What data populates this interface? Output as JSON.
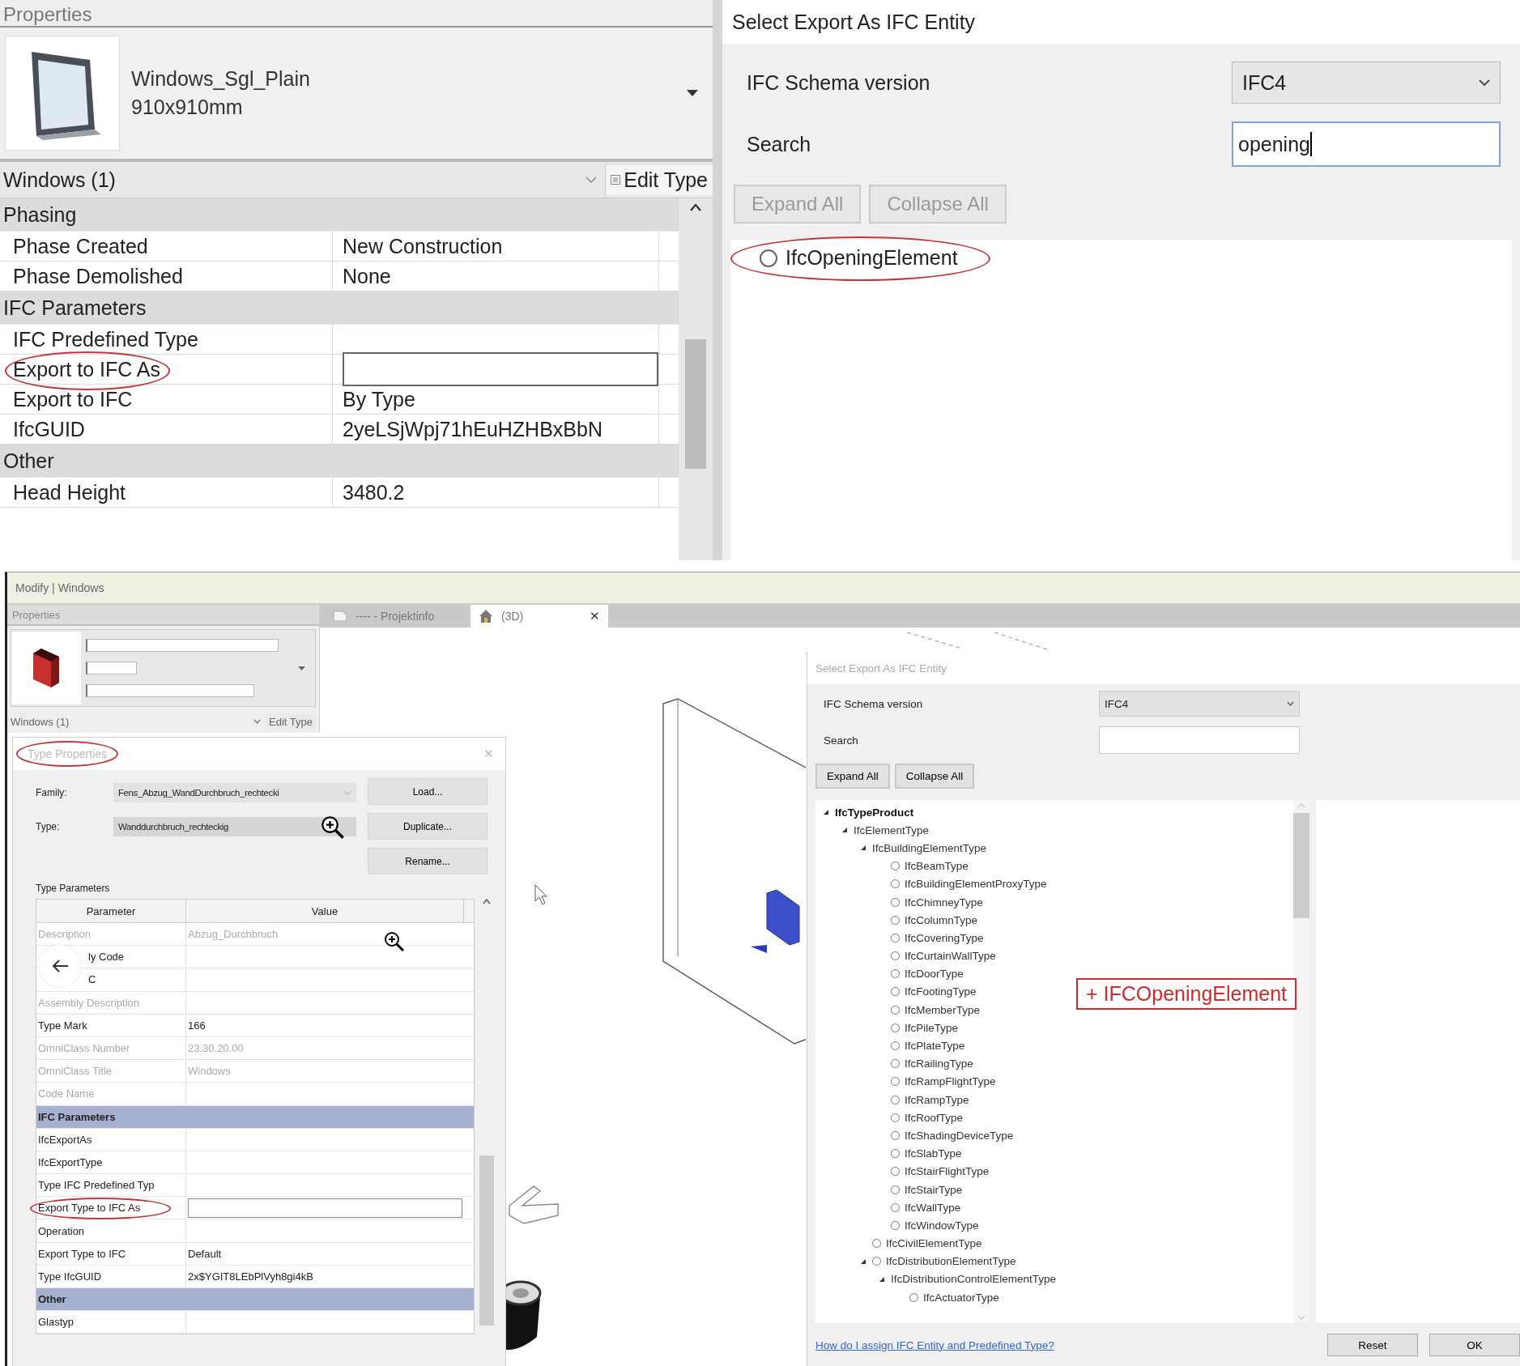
{
  "top_properties": {
    "title": "Properties",
    "type_name": "Windows_Sgl_Plain",
    "type_size": "910x910mm",
    "selector": "Windows (1)",
    "edit_type": "Edit Type",
    "groups": [
      {
        "name": "Phasing",
        "rows": [
          {
            "kind": "text",
            "parameter": "Phase Created",
            "value": "New Construction",
            "circled": false
          },
          {
            "kind": "text",
            "parameter": "Phase Demolished",
            "value": "None",
            "circled": false
          }
        ]
      },
      {
        "name": "IFC Parameters",
        "rows": [
          {
            "kind": "text",
            "parameter": "IFC Predefined Type",
            "circled": false
          },
          {
            "kind": "field",
            "parameter": "Export to IFC As",
            "circled": true
          },
          {
            "kind": "text",
            "parameter": "Export to IFC",
            "value": "By Type",
            "circled": false
          },
          {
            "kind": "text",
            "parameter": "IfcGUID",
            "value": "2yeLSjWpj71hEuHZHBxBbN",
            "circled": false
          }
        ]
      },
      {
        "name": "Other",
        "rows": [
          {
            "kind": "text",
            "parameter": "Head Height",
            "value": "3480.2",
            "circled": false
          }
        ]
      }
    ]
  },
  "top_export": {
    "title": "Select Export As IFC Entity",
    "schema_label": "IFC Schema version",
    "schema_value": "IFC4",
    "search_label": "Search",
    "search_value": "opening",
    "buttons": [
      "Expand All",
      "Collapse All"
    ],
    "results": [
      {
        "label": "IfcOpeningElement",
        "selected": false,
        "circled": true
      }
    ]
  },
  "bottom": {
    "ribbon_title": "Modify | Windows",
    "properties": {
      "title": "Properties",
      "selector": "Windows (1)",
      "edit_type": "Edit Type"
    },
    "tabs": [
      {
        "label": "---- - Projektinfo",
        "selected": false
      },
      {
        "label": "(3D)",
        "selected": true,
        "close": "✕"
      }
    ],
    "type_dialog": {
      "title": "Type Properties",
      "circled": true,
      "close": "✕",
      "family_label": "Family:",
      "family_value": "Fens_Abzug_WandDurchbruch_rechtecki",
      "type_label": "Type:",
      "type_value": "Wanddurchbruch_rechteckig",
      "buttons": [
        "Load...",
        "Duplicate...",
        "Rename..."
      ],
      "section": "Type Parameters",
      "columns": [
        "Parameter",
        "Value"
      ],
      "rows": [
        {
          "kind": "row",
          "parameter": "Description",
          "value": "Abzug_Durchbruch",
          "disabled": true,
          "circled": false
        },
        {
          "kind": "row",
          "parameter": "ly Code",
          "disabled": false,
          "circled": false
        },
        {
          "kind": "row",
          "parameter": "C",
          "disabled": false,
          "circled": false
        },
        {
          "kind": "row",
          "parameter": "Assembly Description",
          "disabled": true,
          "circled": false
        },
        {
          "kind": "row",
          "parameter": "Type Mark",
          "value": "166",
          "disabled": false,
          "circled": false
        },
        {
          "kind": "row",
          "parameter": "OmniClass Number",
          "value": "23.30.20.00",
          "disabled": true,
          "circled": false
        },
        {
          "kind": "row",
          "parameter": "OmniClass Title",
          "value": "Windows",
          "disabled": true,
          "circled": false
        },
        {
          "kind": "row",
          "parameter": "Code Name",
          "disabled": true,
          "circled": false
        },
        {
          "kind": "group",
          "parameter": "IFC Parameters"
        },
        {
          "kind": "row",
          "parameter": "IfcExportAs",
          "disabled": false,
          "circled": false
        },
        {
          "kind": "row",
          "parameter": "IfcExportType",
          "disabled": false,
          "circled": false
        },
        {
          "kind": "row",
          "parameter": "Type IFC Predefined Typ",
          "disabled": false,
          "circled": false
        },
        {
          "kind": "field",
          "parameter": "Export Type to IFC As",
          "disabled": false,
          "circled": true
        },
        {
          "kind": "row",
          "parameter": "Operation",
          "disabled": false,
          "circled": false
        },
        {
          "kind": "row",
          "parameter": "Export Type to IFC",
          "value": "Default",
          "disabled": false,
          "circled": false
        },
        {
          "kind": "row",
          "parameter": "Type IfcGUID",
          "value": "2x$YGIT8LEbPlVyh8gi4kB",
          "disabled": false,
          "circled": false
        },
        {
          "kind": "group",
          "parameter": "Other"
        },
        {
          "kind": "row",
          "parameter": "Glastyp",
          "disabled": false,
          "circled": false
        }
      ]
    },
    "export_dialog": {
      "title": "Select Export As IFC Entity",
      "schema_label": "IFC Schema version",
      "schema_value": "IFC4",
      "search_label": "Search",
      "buttons": [
        "Expand All",
        "Collapse All"
      ],
      "tree": [
        {
          "label": "IfcTypeProduct",
          "kind": "category",
          "expanded": true,
          "children": [
            {
              "label": "IfcElementType",
              "kind": "category",
              "expanded": true,
              "children": [
                {
                  "label": "IfcBuildingElementType",
                  "kind": "category",
                  "expanded": true,
                  "children": [
                    {
                      "label": "IfcBeamType",
                      "kind": "entity",
                      "selected": false
                    },
                    {
                      "label": "IfcBuildingElementProxyType",
                      "kind": "entity",
                      "selected": false
                    },
                    {
                      "label": "IfcChimneyType",
                      "kind": "entity",
                      "selected": false
                    },
                    {
                      "label": "IfcColumnType",
                      "kind": "entity",
                      "selected": false
                    },
                    {
                      "label": "IfcCoveringType",
                      "kind": "entity",
                      "selected": false
                    },
                    {
                      "label": "IfcCurtainWallType",
                      "kind": "entity",
                      "selected": false
                    },
                    {
                      "label": "IfcDoorType",
                      "kind": "entity",
                      "selected": false
                    },
                    {
                      "label": "IfcFootingType",
                      "kind": "entity",
                      "selected": false
                    },
                    {
                      "label": "IfcMemberType",
                      "kind": "entity",
                      "selected": false
                    },
                    {
                      "label": "IfcPileType",
                      "kind": "entity",
                      "selected": false
                    },
                    {
                      "label": "IfcPlateType",
                      "kind": "entity",
                      "selected": false
                    },
                    {
                      "label": "IfcRailingType",
                      "kind": "entity",
                      "selected": false
                    },
                    {
                      "label": "IfcRampFlightType",
                      "kind": "entity",
                      "selected": false
                    },
                    {
                      "label": "IfcRampType",
                      "kind": "entity",
                      "selected": false
                    },
                    {
                      "label": "IfcRoofType",
                      "kind": "entity",
                      "selected": false
                    },
                    {
                      "label": "IfcShadingDeviceType",
                      "kind": "entity",
                      "selected": false
                    },
                    {
                      "label": "IfcSlabType",
                      "kind": "entity",
                      "selected": false
                    },
                    {
                      "label": "IfcStairFlightType",
                      "kind": "entity",
                      "selected": false
                    },
                    {
                      "label": "IfcStairType",
                      "kind": "entity",
                      "selected": false
                    },
                    {
                      "label": "IfcWallType",
                      "kind": "entity",
                      "selected": false
                    },
                    {
                      "label": "IfcWindowType",
                      "kind": "entity",
                      "selected": false
                    }
                  ]
                },
                {
                  "label": "IfcCivilElementType",
                  "kind": "entity",
                  "selected": false
                },
                {
                  "label": "IfcDistributionElementType",
                  "kind": "entity",
                  "selected": false,
                  "expanded": true,
                  "children": [
                    {
                      "label": "IfcDistributionControlElementType",
                      "kind": "category",
                      "expanded": true,
                      "children": [
                        {
                          "label": "IfcActuatorType",
                          "kind": "entity",
                          "selected": false
                        }
                      ]
                    }
                  ]
                }
              ]
            }
          ]
        }
      ],
      "annotation": "+ IFCOpeningElement",
      "help_link": "How do I assign IFC Entity and Predefined Type?",
      "footer_buttons": [
        "Reset",
        "OK"
      ]
    }
  }
}
